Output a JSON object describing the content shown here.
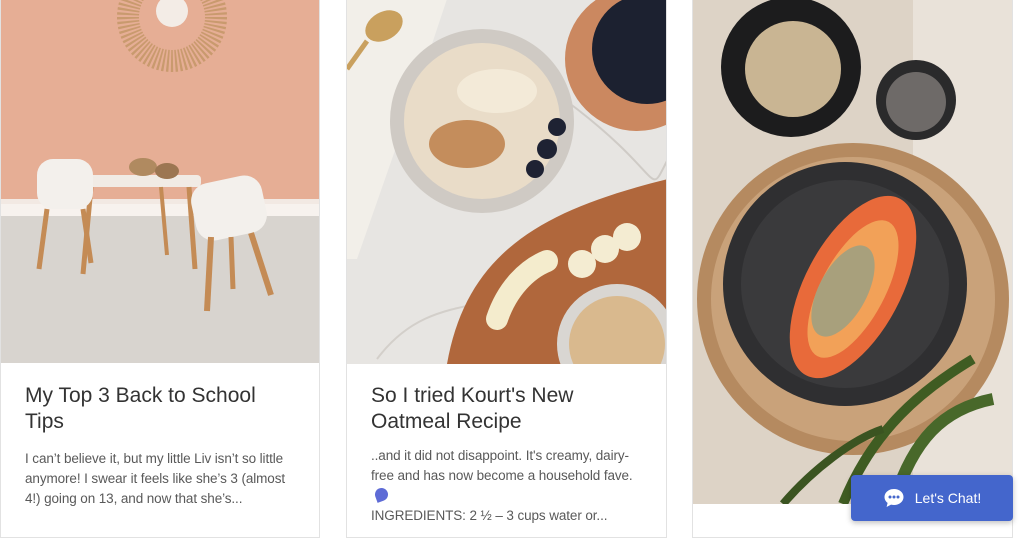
{
  "posts": [
    {
      "title": "My Top 3 Back to School Tips",
      "excerpt": "I can’t believe it, but my little Liv isn’t so little anymore! I swear it feels like she’s 3 (almost 4!) going on 13, and now that she’s..."
    },
    {
      "title": "So I tried Kourt's New Oatmeal Recipe",
      "excerpt_main": "..and it did not disappoint. It's creamy, dairy-free and has now become a household fave.",
      "excerpt_tail": "INGREDIENTS: 2 ½ – 3 cups water or..."
    },
    {
      "title": "",
      "excerpt": ""
    }
  ],
  "chat": {
    "label": "Let's Chat!",
    "icon": "chat-bubble-icon"
  },
  "colors": {
    "chat_bg": "#4466cc",
    "wall": "#e6ae95",
    "text": "#333333"
  }
}
